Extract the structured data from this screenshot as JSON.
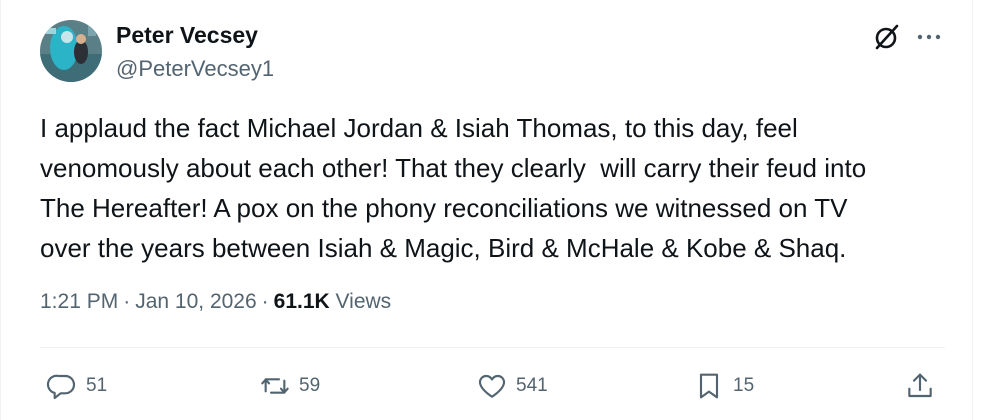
{
  "author": {
    "name": "Peter Vecsey",
    "handle": "@PeterVecsey1",
    "avatar_icon": "profile-photo"
  },
  "header_icons": {
    "grok": "grok-icon",
    "more": "more-options-icon"
  },
  "tweet": {
    "lines": [
      "I applaud the fact Michael Jordan & Isiah Thomas, to this day, feel",
      "venomously about each other! That they clearly  will carry their feud into",
      "The Hereafter! A pox on the phony reconciliations we witnessed on TV",
      "over the years between Isiah & Magic, Bird & McHale & Kobe & Shaq."
    ]
  },
  "meta": {
    "time": "1:21 PM",
    "separator": "·",
    "date": "Jan 10, 2026",
    "views_count": "61.1K",
    "views_label": "Views"
  },
  "actions": {
    "reply": {
      "count": "51",
      "icon": "reply-icon"
    },
    "retweet": {
      "count": "59",
      "icon": "retweet-icon"
    },
    "like": {
      "count": "541",
      "icon": "heart-icon"
    },
    "bookmark": {
      "count": "15",
      "icon": "bookmark-icon"
    },
    "share": {
      "icon": "share-icon"
    }
  },
  "colors": {
    "text_primary": "#0f1419",
    "text_secondary": "#536471",
    "divider": "#eff3f4"
  }
}
